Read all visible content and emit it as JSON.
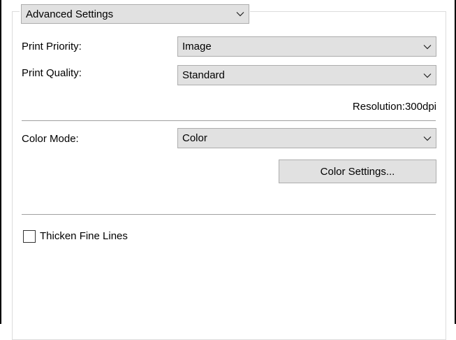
{
  "section_select": {
    "value": "Advanced Settings"
  },
  "print_priority": {
    "label": "Print Priority:",
    "value": "Image"
  },
  "print_quality": {
    "label": "Print Quality:",
    "value": "Standard"
  },
  "resolution": {
    "text": "Resolution:300dpi"
  },
  "color_mode": {
    "label": "Color Mode:",
    "value": "Color"
  },
  "color_settings_button": {
    "label": "Color Settings..."
  },
  "thicken_fine_lines": {
    "label": "Thicken Fine Lines",
    "checked": false
  }
}
